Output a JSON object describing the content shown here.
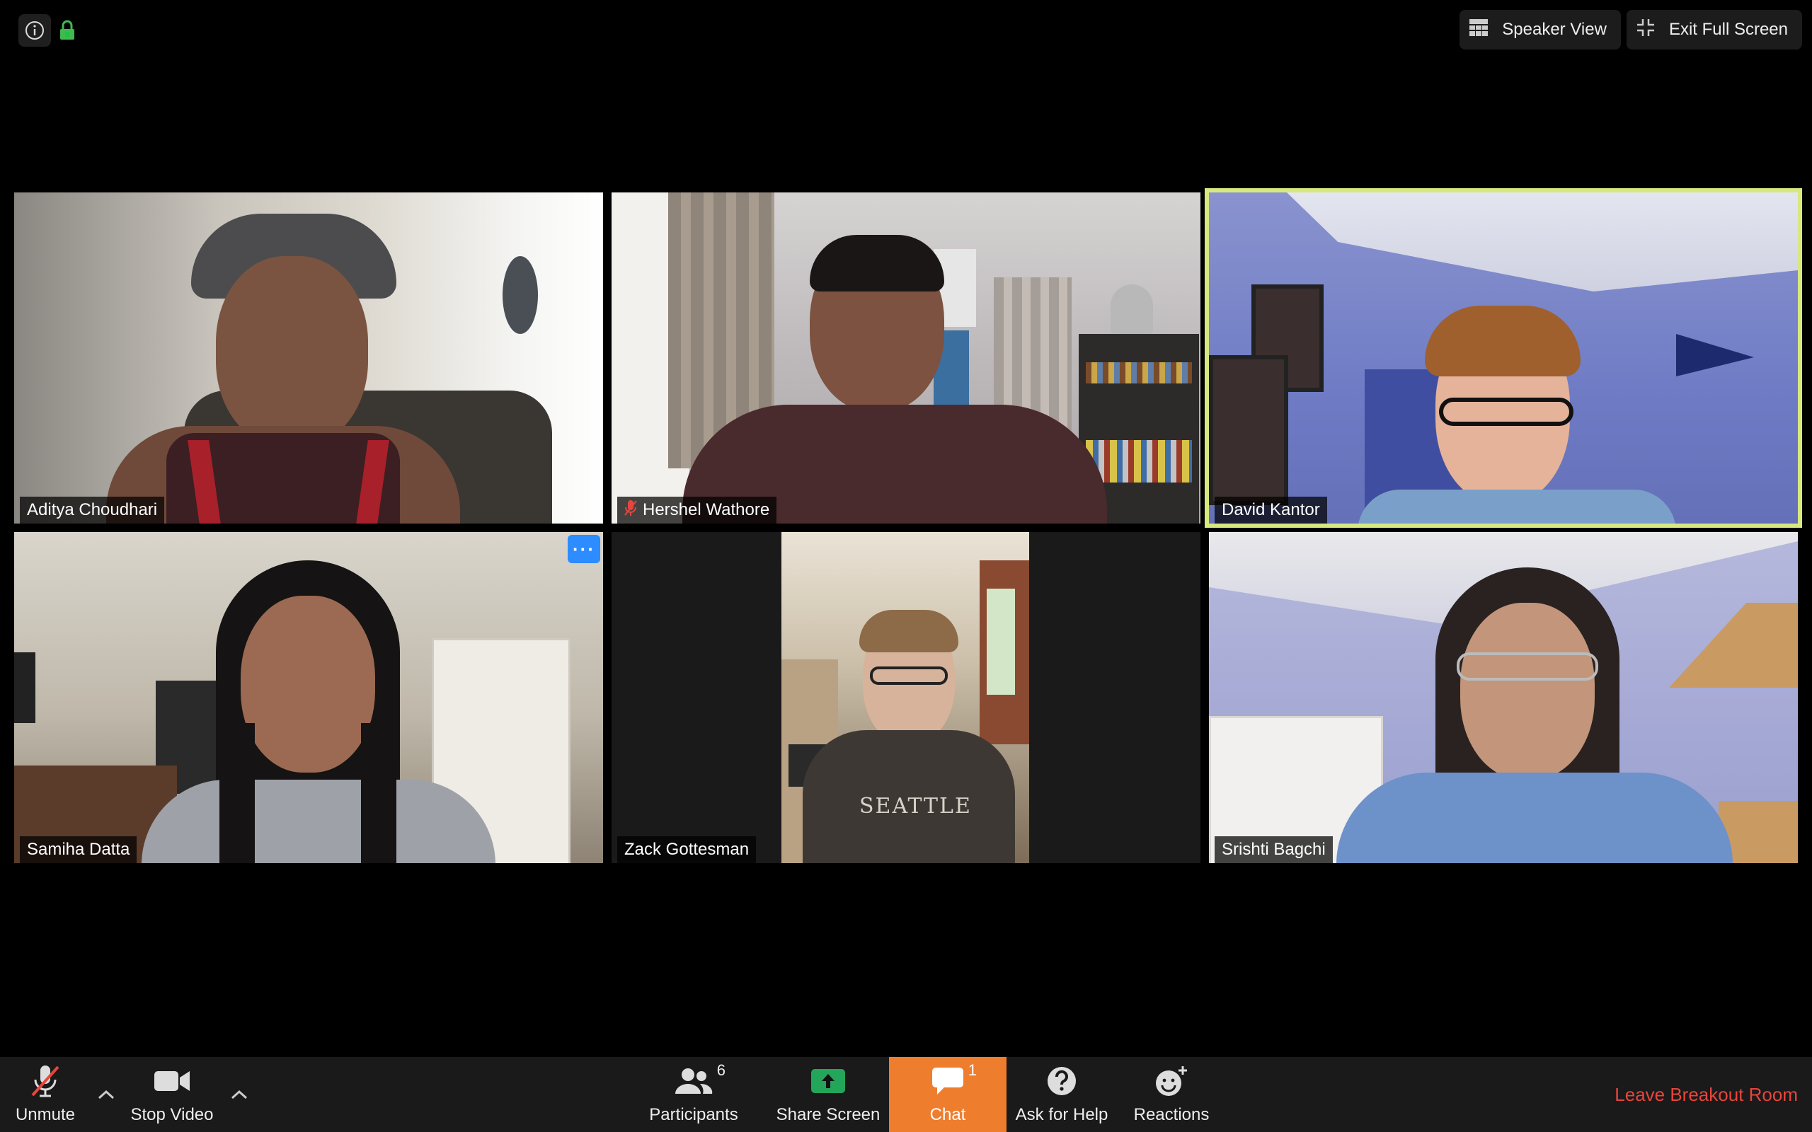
{
  "top": {
    "speaker_view": "Speaker View",
    "exit_full_screen": "Exit Full Screen"
  },
  "participants": [
    {
      "name": "Aditya Choudhari",
      "muted": false
    },
    {
      "name": "Hershel Wathore",
      "muted": true
    },
    {
      "name": "David Kantor",
      "muted": false,
      "active_speaker": true
    },
    {
      "name": "Samiha Datta",
      "muted": false
    },
    {
      "name": "Zack Gottesman",
      "muted": false
    },
    {
      "name": "Srishti Bagchi",
      "muted": false
    }
  ],
  "toolbar": {
    "unmute": "Unmute",
    "stop_video": "Stop Video",
    "participants": "Participants",
    "participants_count": "6",
    "share_screen": "Share Screen",
    "chat": "Chat",
    "chat_count": "1",
    "ask_for_help": "Ask for Help",
    "reactions": "Reactions",
    "leave": "Leave Breakout Room"
  },
  "colors": {
    "active_speaker_border": "#d8e880",
    "chat_accent": "#ef7d2e",
    "leave_text": "#e8453c",
    "more_button": "#2d8cff",
    "share_green": "#23a55a"
  },
  "icons": [
    "info-icon",
    "lock-icon",
    "grid-icon",
    "exit-fullscreen-icon",
    "mic-muted-icon",
    "video-camera-icon",
    "participants-icon",
    "share-screen-icon",
    "chat-bubble-icon",
    "question-icon",
    "reactions-icon"
  ]
}
